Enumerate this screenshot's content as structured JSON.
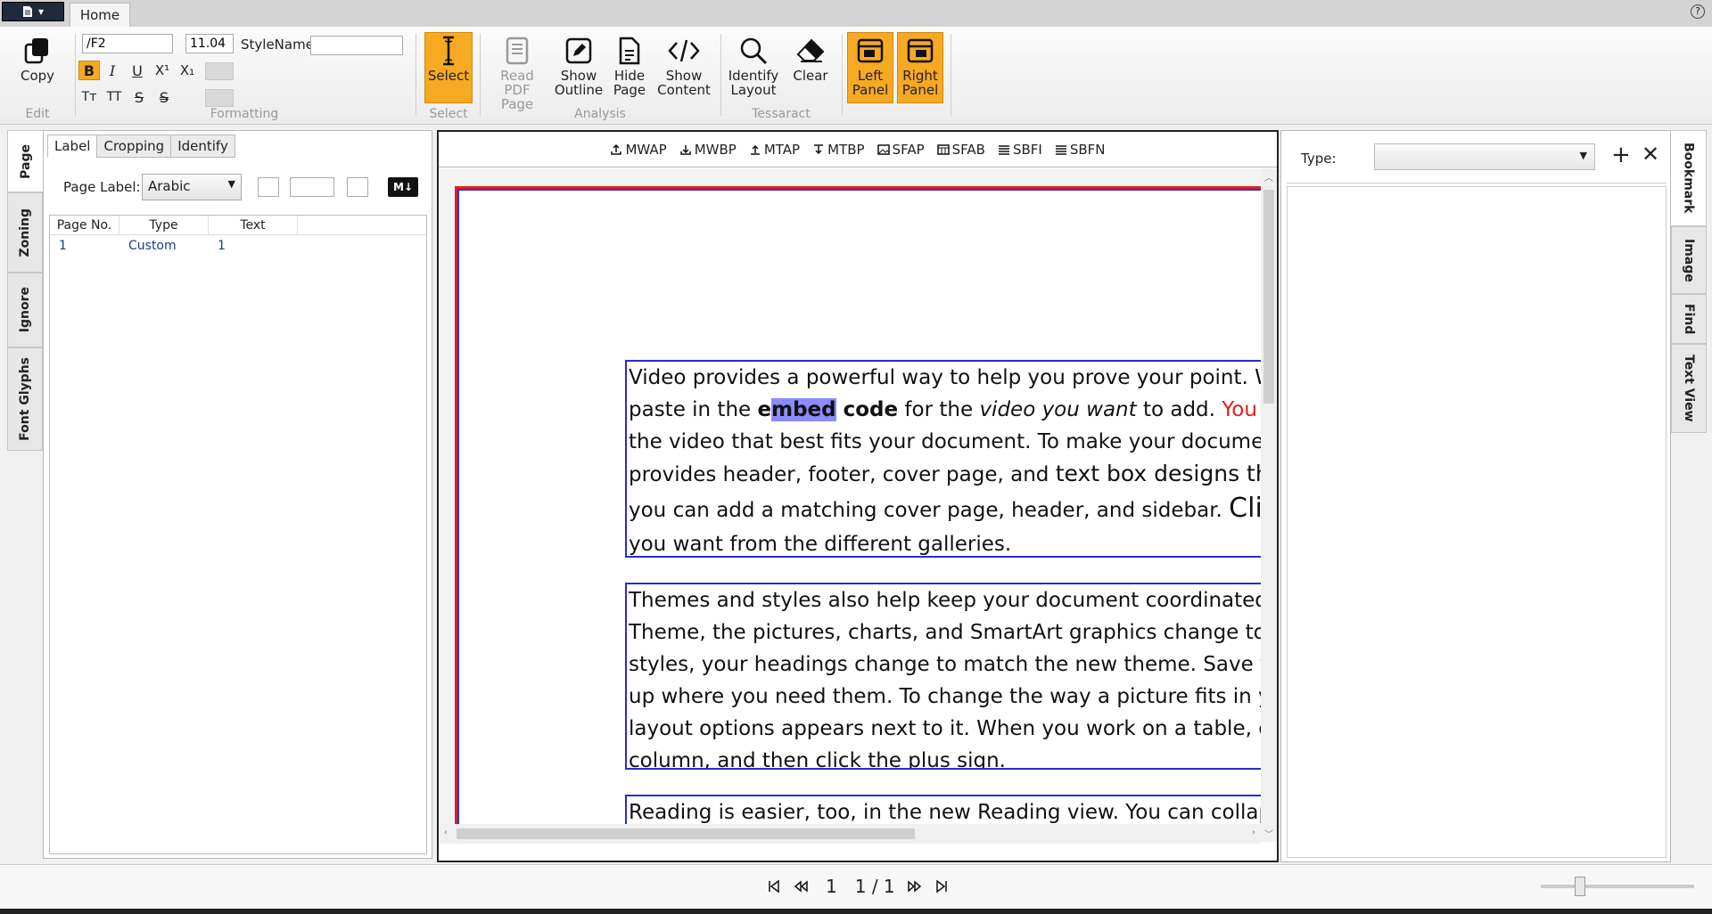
{
  "window": {
    "tab": "Home",
    "help": "?"
  },
  "ribbon": {
    "edit": {
      "copy": "Copy",
      "label": "Edit"
    },
    "formatting": {
      "font": "/F2",
      "size": "11.04",
      "style_label": "StyleName",
      "style_value": "",
      "bold": "B",
      "italic": "I",
      "underline": "U",
      "superscript": "X¹",
      "subscript": "X₁",
      "small_caps": "Tт",
      "all_caps": "TT",
      "strike": "S",
      "double_strike": "S",
      "label": "Formatting"
    },
    "select": {
      "btn": "Select",
      "label": "Select"
    },
    "analysis": {
      "read_pdf_1": "Read PDF",
      "read_pdf_2": "Page",
      "show_outline_1": "Show",
      "show_outline_2": "Outline",
      "hide_page_1": "Hide",
      "hide_page_2": "Page",
      "show_content_1": "Show",
      "show_content_2": "Content",
      "label": "Analysis"
    },
    "tessaract": {
      "identify_1": "Identify",
      "identify_2": "Layout",
      "clear": "Clear",
      "label": "Tessaract"
    },
    "panels": {
      "left_1": "Left",
      "left_2": "Panel",
      "right_1": "Right",
      "right_2": "Panel"
    }
  },
  "left_vtabs": [
    "Page",
    "Zoning",
    "Ignore",
    "Font Glyphs"
  ],
  "left_panel": {
    "tabs": [
      "Label",
      "Cropping",
      "Identify"
    ],
    "page_label": "Page Label:",
    "page_label_value": "Arabic",
    "md_badge": "M↓",
    "columns": [
      "Page No.",
      "Type",
      "Text"
    ],
    "rows": [
      {
        "page": "1",
        "type": "Custom",
        "text": "1"
      }
    ]
  },
  "doc_toolbar": [
    "MWAP",
    "MWBP",
    "MTAP",
    "MTBP",
    "SFAP",
    "SFAB",
    "SBFI",
    "SBFN"
  ],
  "document": {
    "p1": {
      "l1": "Video provides a powerful way to help you prove your point. Wh",
      "l2a": "paste in the ",
      "l2b": "e",
      "l2c": "mbed",
      "l2d": " code",
      "l2e": " for the ",
      "l2f": "video you want",
      "l2g": " to add. ",
      "l2h": "You can",
      "l3": "the video that best fits your document. To make your document",
      "l4a": "provides header, footer, cover page, and ",
      "l4b": "text box designs that",
      "l5a": "you can add a matching cover page, header, and sidebar. ",
      "l5b": "Click",
      "l6": "you want from the different galleries."
    },
    "p2": [
      "Themes and styles also help keep your document coordinated. W",
      "Theme, the pictures, charts, and SmartArt graphics change to ma",
      "styles, your headings change to match the new theme. Save time",
      "up where you need them. To change the way a picture fits in you",
      "layout options appears next to it. When you work on a table, clic",
      "column, and then click the plus sign."
    ],
    "p3": [
      "Reading is easier, too, in the new Reading view. You can collapse"
    ]
  },
  "right_panel": {
    "type_label": "Type:",
    "type_value": "",
    "add": "+",
    "close": "✕"
  },
  "right_vtabs": [
    "Bookmark",
    "Image",
    "Find",
    "Text View"
  ],
  "nav": {
    "current": "1",
    "total": "1 / 1"
  },
  "colors": {
    "accent": "#f7a922",
    "block_border": "#2b2bd0",
    "page_border": "#e01e1e"
  }
}
